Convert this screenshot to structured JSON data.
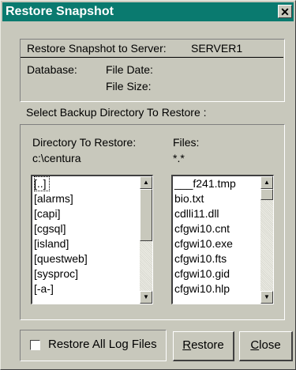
{
  "window": {
    "title": "Restore Snapshot",
    "close_glyph": "✕"
  },
  "header": {
    "server_label": "Restore Snapshot to Server:",
    "server_name": "SERVER1",
    "database_label": "Database:",
    "file_date_label": "File Date:",
    "file_size_label": "File Size:"
  },
  "select_label": "Select Backup Directory To Restore :",
  "directory": {
    "label": "Directory To Restore:",
    "path": "c:\\centura",
    "items": [
      "[..]",
      "[alarms]",
      "[capi]",
      "[cgsql]",
      "[island]",
      "[questweb]",
      "[sysproc]",
      "[-a-]"
    ]
  },
  "files": {
    "label": "Files:",
    "pattern": "*.*",
    "items": [
      "___f241.tmp",
      "bio.txt",
      "cdlli11.dll",
      "cfgwi10.cnt",
      "cfgwi10.exe",
      "cfgwi10.fts",
      "cfgwi10.gid",
      "cfgwi10.hlp"
    ]
  },
  "footer": {
    "restore_all_log_label": "Restore All Log Files",
    "restore_all_log_checked": false,
    "restore_button_accel": "R",
    "restore_button_rest": "estore",
    "close_button_accel": "C",
    "close_button_rest": "lose"
  },
  "icons": {
    "scroll_up": "▲",
    "scroll_down": "▼"
  }
}
